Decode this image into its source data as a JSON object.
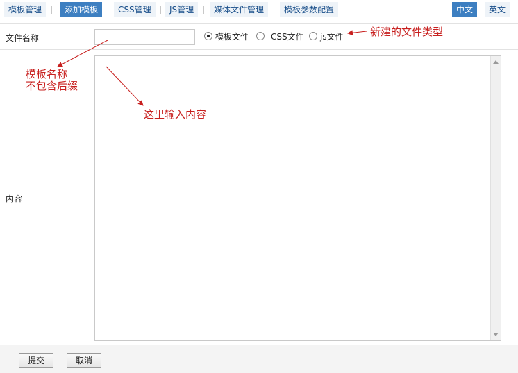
{
  "tabs": [
    {
      "label": "模板管理",
      "active": false
    },
    {
      "label": "添加模板",
      "active": true
    },
    {
      "label": "CSS管理",
      "active": false
    },
    {
      "label": "JS管理",
      "active": false
    },
    {
      "label": "媒体文件管理",
      "active": false
    },
    {
      "label": "模板参数配置",
      "active": false
    }
  ],
  "lang": {
    "zh": "中文",
    "en": "英文",
    "active": "zh"
  },
  "form": {
    "name_label": "文件名称",
    "name_value": "",
    "content_label": "内容",
    "content_value": "",
    "file_types": [
      {
        "label": "模板文件",
        "checked": true
      },
      {
        "label": "CSS文件",
        "checked": false
      },
      {
        "label": "js文件",
        "checked": false
      }
    ]
  },
  "buttons": {
    "submit": "提交",
    "cancel": "取消"
  },
  "annotations": {
    "file_type": "新建的文件类型",
    "name_line1": "模板名称",
    "name_line2": "不包含后缀",
    "content": "这里输入内容"
  },
  "colors": {
    "accent": "#3d7fc1",
    "annotation": "#c8201f"
  }
}
